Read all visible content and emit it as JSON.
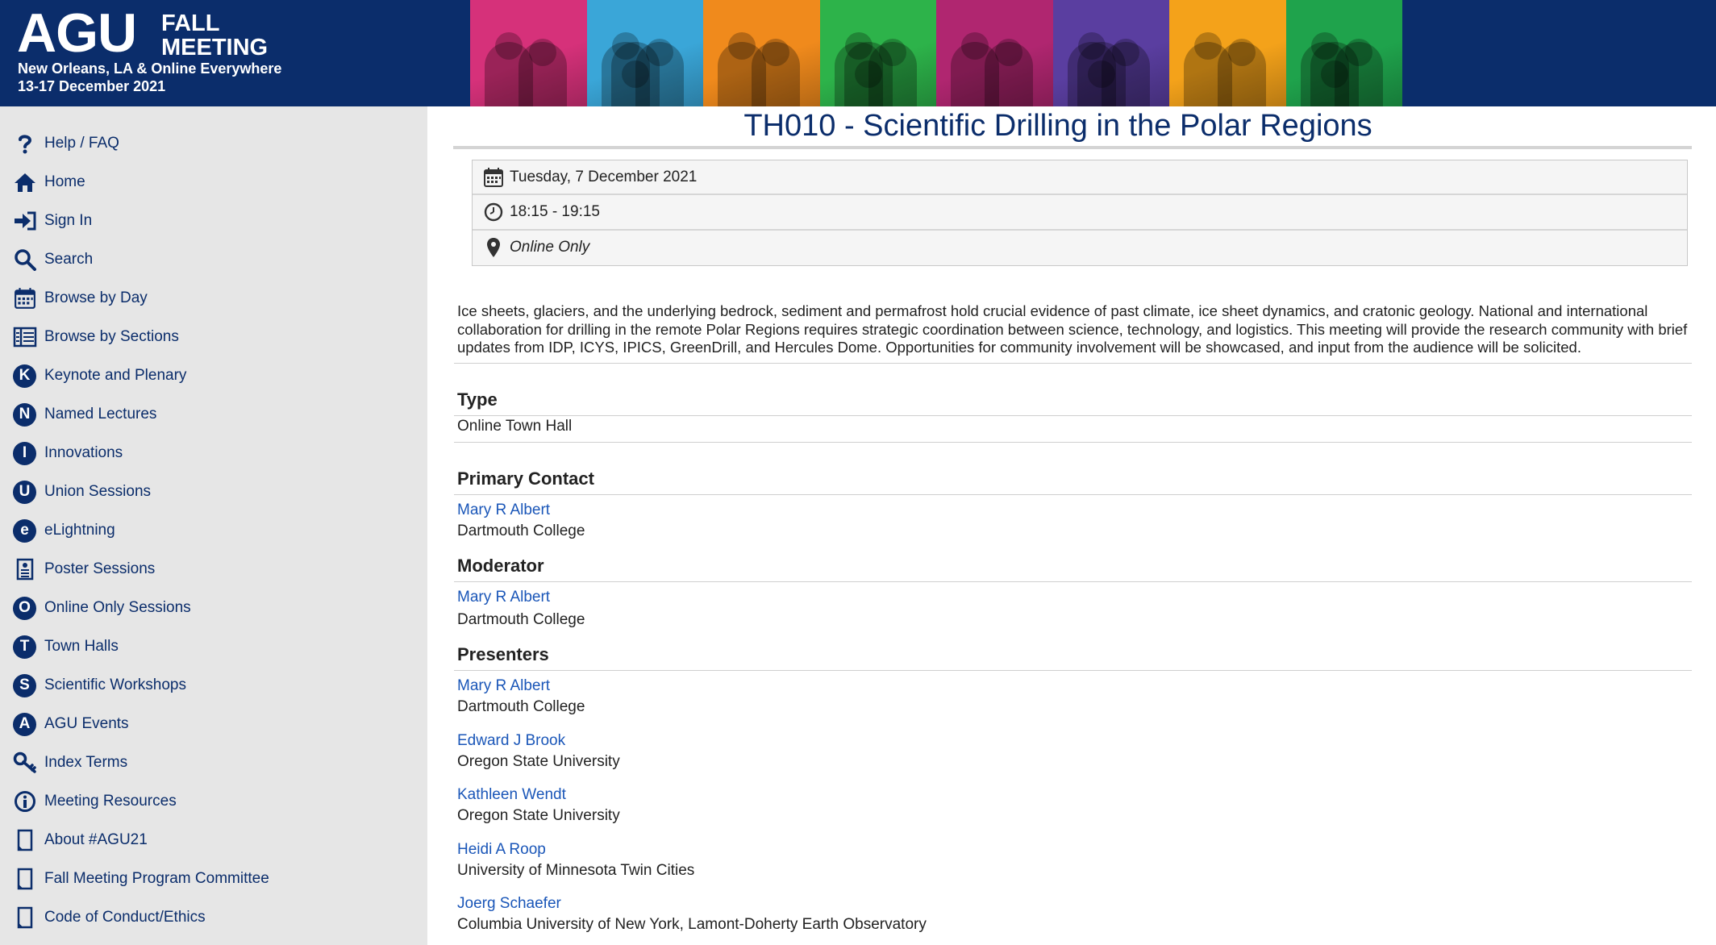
{
  "header": {
    "logo": "AGU",
    "event_line1": "FALL",
    "event_line2": "MEETING",
    "location": "New Orleans, LA & Online Everywhere",
    "dates": "13-17 December 2021",
    "banner_colors": [
      "#d6317a",
      "#3aa6d8",
      "#f08a1c",
      "#2db34a",
      "#b02670",
      "#5a3ea0",
      "#f4a21a",
      "#1fa34c"
    ]
  },
  "sidebar": {
    "items": [
      {
        "label": "Help / FAQ",
        "icon": "question-icon"
      },
      {
        "label": "Home",
        "icon": "home-icon"
      },
      {
        "label": "Sign In",
        "icon": "sign-in-icon"
      },
      {
        "label": "Search",
        "icon": "search-icon"
      },
      {
        "label": "Browse by Day",
        "icon": "calendar-icon"
      },
      {
        "label": "Browse by Sections",
        "icon": "sections-icon"
      },
      {
        "label": "Keynote and Plenary",
        "icon": "letter-k-icon",
        "letter": "K"
      },
      {
        "label": "Named Lectures",
        "icon": "letter-n-icon",
        "letter": "N"
      },
      {
        "label": "Innovations",
        "icon": "letter-i-icon",
        "letter": "I"
      },
      {
        "label": "Union Sessions",
        "icon": "letter-u-icon",
        "letter": "U"
      },
      {
        "label": "eLightning",
        "icon": "letter-e-icon",
        "letter": "e"
      },
      {
        "label": "Poster Sessions",
        "icon": "poster-icon"
      },
      {
        "label": "Online Only Sessions",
        "icon": "letter-o-icon",
        "letter": "O"
      },
      {
        "label": "Town Halls",
        "icon": "letter-t-icon",
        "letter": "T"
      },
      {
        "label": "Scientific Workshops",
        "icon": "letter-s-icon",
        "letter": "S"
      },
      {
        "label": "AGU Events",
        "icon": "letter-a-icon",
        "letter": "A"
      },
      {
        "label": "Index Terms",
        "icon": "key-icon"
      },
      {
        "label": "Meeting Resources",
        "icon": "info-icon"
      },
      {
        "label": "About #AGU21",
        "icon": "page-icon"
      },
      {
        "label": "Fall Meeting Program Committee",
        "icon": "page-icon"
      },
      {
        "label": "Code of Conduct/Ethics",
        "icon": "page-icon"
      }
    ]
  },
  "session": {
    "title": "TH010 - Scientific Drilling in the Polar Regions",
    "date": "Tuesday, 7 December 2021",
    "time": "18:15 - 19:15",
    "location": "Online Only",
    "description": "Ice sheets, glaciers, and the underlying bedrock, sediment and permafrost hold crucial evidence of past climate, ice sheet dynamics, and cratonic geology. National and international collaboration for drilling in the remote Polar Regions requires strategic coordination between science, technology, and logistics. This meeting will provide the research community with brief updates from IDP, ICYS, IPICS, GreenDrill, and Hercules Dome. Opportunities for community involvement will be showcased, and input from the audience will be solicited.",
    "type_heading": "Type",
    "type_value": "Online Town Hall",
    "primary_contact_heading": "Primary Contact",
    "primary_contact": {
      "name": "Mary R Albert",
      "affiliation": "Dartmouth College"
    },
    "moderator_heading": "Moderator",
    "moderator": {
      "name": "Mary R Albert",
      "affiliation": "Dartmouth College"
    },
    "presenters_heading": "Presenters",
    "presenters": [
      {
        "name": "Mary R Albert",
        "affiliation": "Dartmouth College"
      },
      {
        "name": "Edward J Brook",
        "affiliation": "Oregon State University"
      },
      {
        "name": "Kathleen Wendt",
        "affiliation": "Oregon State University"
      },
      {
        "name": "Heidi A Roop",
        "affiliation": "University of Minnesota Twin Cities"
      },
      {
        "name": "Joerg Schaefer",
        "affiliation": "Columbia University of New York, Lamont-Doherty Earth Observatory"
      }
    ]
  },
  "colors": {
    "brand_navy": "#0b2d6b",
    "link_blue": "#1a56b8",
    "sidebar_bg": "#e6e6e6"
  }
}
